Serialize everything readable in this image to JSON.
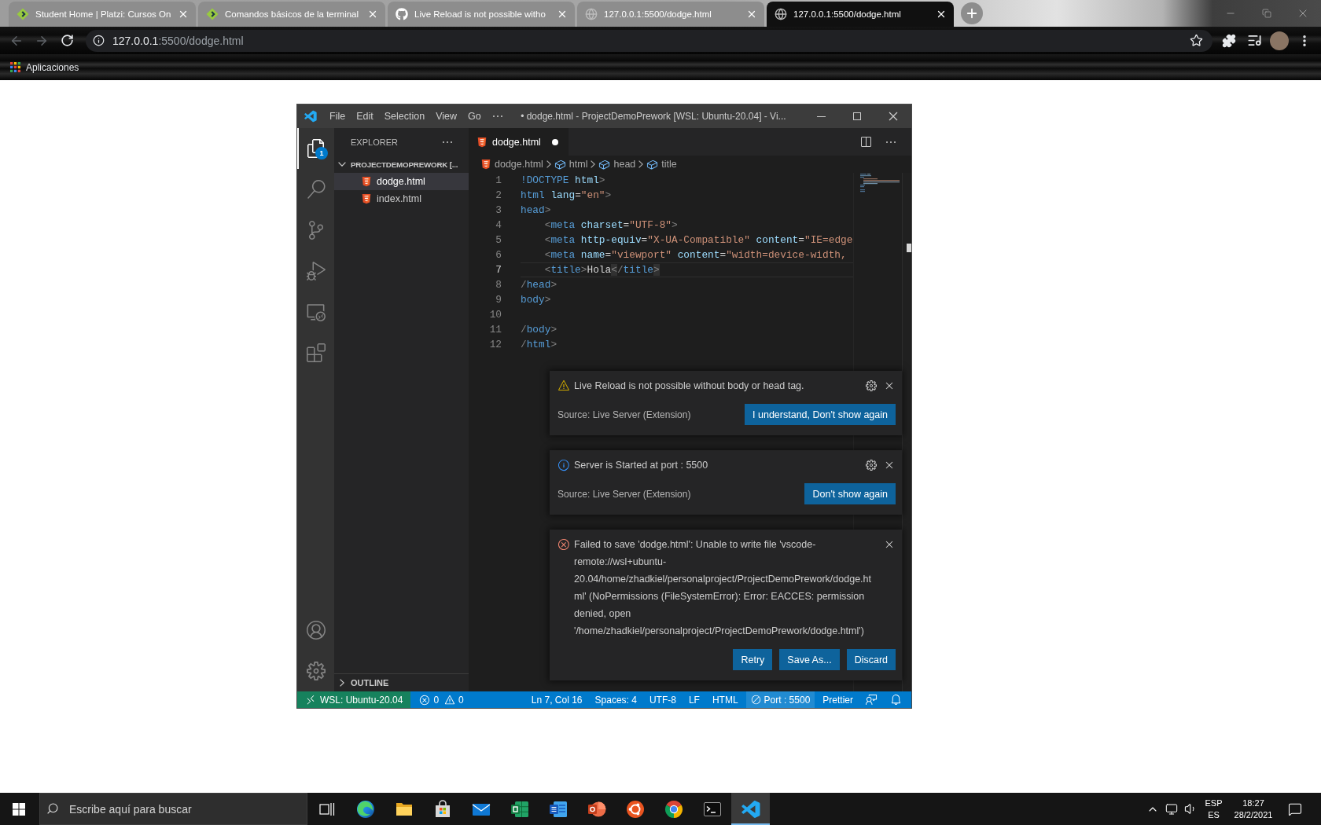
{
  "browser": {
    "tabs": [
      {
        "kind": "platzi",
        "title": "Student Home | Platzi: Cursos On",
        "selected": false
      },
      {
        "kind": "platzi",
        "title": "Comandos básicos de la terminal",
        "selected": false
      },
      {
        "kind": "github",
        "title": "Live Reload is not possible witho",
        "selected": false
      },
      {
        "kind": "globe",
        "title": "127.0.0.1:5500/dodge.html",
        "selected": false
      },
      {
        "kind": "globe",
        "title": "127.0.0.1:5500/dodge.html",
        "selected": true
      }
    ],
    "back": {
      "disabled": true
    },
    "forward": {
      "disabled": true
    },
    "address": {
      "host": "127.0.0.1",
      "path": ":5500/dodge.html"
    },
    "bookmarks": [
      {
        "label": "Aplicaciones"
      }
    ]
  },
  "vscode": {
    "title_bar": {
      "menu": [
        "File",
        "Edit",
        "Selection",
        "View",
        "Go"
      ],
      "title": "• dodge.html - ProjectDemoPrework [WSL: Ubuntu-20.04] - Vi..."
    },
    "activity_bar": {
      "top": [
        {
          "kind": "explorer",
          "selected": true,
          "badge": "1"
        },
        {
          "kind": "search",
          "selected": false
        },
        {
          "kind": "source_control",
          "selected": false
        },
        {
          "kind": "run",
          "selected": false
        },
        {
          "kind": "remote",
          "selected": false
        },
        {
          "kind": "extensions",
          "selected": false
        }
      ],
      "bottom": [
        {
          "kind": "accounts"
        },
        {
          "kind": "manage"
        }
      ]
    },
    "explorer": {
      "title": "EXPLORER",
      "folder": {
        "name": "PROJECTDEMOPREWORK [...",
        "expanded": true,
        "files": [
          {
            "name": "dodge.html",
            "selected": true
          },
          {
            "name": "index.html",
            "selected": false
          }
        ]
      },
      "outline": {
        "title": "OUTLINE",
        "expanded": false
      }
    },
    "editor": {
      "tabs": [
        {
          "name": "dodge.html",
          "selected": true,
          "dirty": true
        }
      ],
      "breadcrumbs": [
        {
          "kind": "file",
          "text": "dodge.html"
        },
        {
          "kind": "symbol",
          "text": "html"
        },
        {
          "kind": "symbol",
          "text": "head"
        },
        {
          "kind": "symbol",
          "text": "title"
        }
      ],
      "lines": [
        {
          "number": "1",
          "current": false,
          "tokens": [
            {
              "text": "!DOCTYPE",
              "kind": "tag"
            },
            {
              "text": " html",
              "kind": "attr"
            },
            {
              "text": ">",
              "kind": "punct"
            }
          ]
        },
        {
          "number": "2",
          "current": false,
          "tokens": [
            {
              "text": "html",
              "kind": "tag"
            },
            {
              "text": " lang",
              "kind": "attr"
            },
            {
              "text": "=",
              "kind": "text"
            },
            {
              "text": "\"en\"",
              "kind": "string"
            },
            {
              "text": ">",
              "kind": "punct"
            }
          ]
        },
        {
          "number": "3",
          "current": false,
          "tokens": [
            {
              "text": "head",
              "kind": "tag"
            },
            {
              "text": ">",
              "kind": "punct"
            }
          ]
        },
        {
          "number": "4",
          "current": false,
          "tokens": [
            {
              "text": "    <",
              "kind": "punct"
            },
            {
              "text": "meta",
              "kind": "tag"
            },
            {
              "text": " charset",
              "kind": "attr"
            },
            {
              "text": "=",
              "kind": "text"
            },
            {
              "text": "\"UTF-8\"",
              "kind": "string"
            },
            {
              "text": ">",
              "kind": "punct"
            }
          ]
        },
        {
          "number": "5",
          "current": false,
          "tokens": [
            {
              "text": "    <",
              "kind": "punct"
            },
            {
              "text": "meta",
              "kind": "tag"
            },
            {
              "text": " http-equiv",
              "kind": "attr"
            },
            {
              "text": "=",
              "kind": "text"
            },
            {
              "text": "\"X-UA-Compatible\"",
              "kind": "string"
            },
            {
              "text": " content",
              "kind": "attr"
            },
            {
              "text": "=",
              "kind": "text"
            },
            {
              "text": "\"IE=edge",
              "kind": "string"
            }
          ]
        },
        {
          "number": "6",
          "current": false,
          "tokens": [
            {
              "text": "    <",
              "kind": "punct"
            },
            {
              "text": "meta",
              "kind": "tag"
            },
            {
              "text": " name",
              "kind": "attr"
            },
            {
              "text": "=",
              "kind": "text"
            },
            {
              "text": "\"viewport\"",
              "kind": "string"
            },
            {
              "text": " content",
              "kind": "attr"
            },
            {
              "text": "=",
              "kind": "text"
            },
            {
              "text": "\"width=device-width,",
              "kind": "string"
            }
          ]
        },
        {
          "number": "7",
          "current": true,
          "tokens": [
            {
              "text": "    <",
              "kind": "punct"
            },
            {
              "text": "title",
              "kind": "tag"
            },
            {
              "text": ">",
              "kind": "punct"
            },
            {
              "text": "Hola",
              "kind": "text"
            },
            {
              "text": "<",
              "kind": "match"
            },
            {
              "text": "/",
              "kind": "punct"
            },
            {
              "text": "title",
              "kind": "tag"
            },
            {
              "text": ">",
              "kind": "match"
            }
          ]
        },
        {
          "number": "8",
          "current": false,
          "tokens": [
            {
              "text": "/",
              "kind": "punct"
            },
            {
              "text": "head",
              "kind": "tag"
            },
            {
              "text": ">",
              "kind": "punct"
            }
          ]
        },
        {
          "number": "9",
          "current": false,
          "tokens": [
            {
              "text": "body",
              "kind": "tag"
            },
            {
              "text": ">",
              "kind": "punct"
            }
          ]
        },
        {
          "number": "10",
          "current": false
        },
        {
          "number": "11",
          "current": false,
          "tokens": [
            {
              "text": "/",
              "kind": "punct"
            },
            {
              "text": "body",
              "kind": "tag"
            },
            {
              "text": ">",
              "kind": "punct"
            }
          ]
        },
        {
          "number": "12",
          "current": false,
          "tokens": [
            {
              "text": "/",
              "kind": "punct"
            },
            {
              "text": "html",
              "kind": "tag"
            },
            {
              "text": ">",
              "kind": "punct"
            }
          ]
        }
      ]
    },
    "notifications": [
      {
        "kind": "warning",
        "message": "Live Reload is not possible without body or head tag.",
        "settings": true,
        "source": "Source: Live Server (Extension)",
        "buttons": [
          "I understand, Don't show again"
        ]
      },
      {
        "kind": "info",
        "message": "Server is Started at port : 5500",
        "settings": true,
        "source": "Source: Live Server (Extension)",
        "buttons": [
          "Don't show again"
        ]
      },
      {
        "kind": "error",
        "message": "Failed to save 'dodge.html': Unable to write file 'vscode-remote://wsl+ubuntu-20.04/home/zhadkiel/personalproject/ProjectDemoPrework/dodge.html' (NoPermissions (FileSystemError): Error: EACCES: permission denied, open '/home/zhadkiel/personalproject/ProjectDemoPrework/dodge.html')",
        "settings": false,
        "buttons": [
          "Retry",
          "Save As...",
          "Discard"
        ]
      }
    ],
    "status_bar": {
      "remote": "WSL: Ubuntu-20.04",
      "problems": {
        "errors": "0",
        "warnings": "0"
      },
      "items": [
        {
          "kind": "text",
          "text": "Ln 7, Col 16"
        },
        {
          "kind": "text",
          "text": "Spaces: 4"
        },
        {
          "kind": "text",
          "text": "UTF-8"
        },
        {
          "kind": "text",
          "text": "LF"
        },
        {
          "kind": "text",
          "text": "HTML"
        },
        {
          "kind": "port",
          "text": "Port : 5500"
        },
        {
          "kind": "text",
          "text": "Prettier"
        },
        {
          "kind": "feedback"
        },
        {
          "kind": "bell"
        }
      ]
    }
  },
  "taskbar": {
    "search": {
      "placeholder": "Escribe aquí para buscar"
    },
    "apps": [
      {
        "kind": "edge",
        "selected": false
      },
      {
        "kind": "files",
        "selected": false
      },
      {
        "kind": "store",
        "selected": false
      },
      {
        "kind": "mail",
        "selected": false
      },
      {
        "kind": "sheet",
        "selected": false
      },
      {
        "kind": "doc",
        "selected": false
      },
      {
        "kind": "slides",
        "selected": false
      },
      {
        "kind": "ubuntu",
        "selected": false
      },
      {
        "kind": "chrome",
        "selected": false
      },
      {
        "kind": "terminal",
        "selected": false
      },
      {
        "kind": "vscode",
        "selected": true
      }
    ],
    "tray": {
      "language": "ESP",
      "layout": "ES",
      "time": "18:27",
      "date": "28/2/2021"
    }
  }
}
